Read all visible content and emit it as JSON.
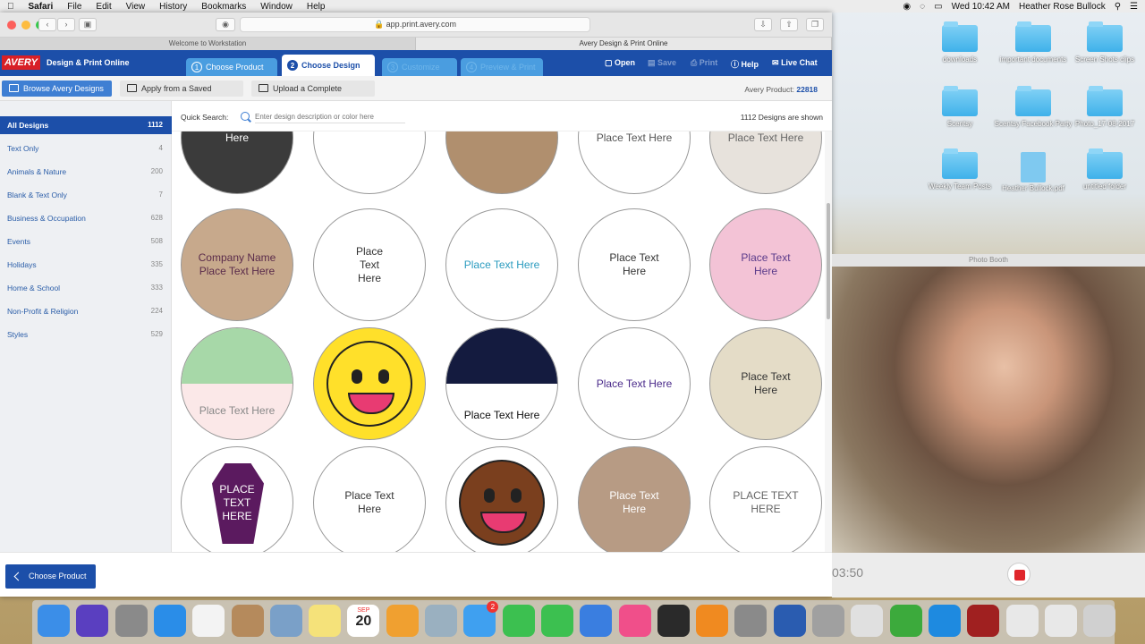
{
  "menubar": {
    "app": "Safari",
    "items": [
      "File",
      "Edit",
      "View",
      "History",
      "Bookmarks",
      "Window",
      "Help"
    ],
    "clock": "Wed 10:42 AM",
    "user": "Heather Rose Bullock"
  },
  "browser": {
    "url": "app.print.avery.com",
    "tabs": [
      "Welcome to Workstation",
      "Avery Design & Print Online"
    ]
  },
  "avery": {
    "logo": "AVERY",
    "product_label": "Design & Print Online",
    "steps": [
      {
        "num": "1",
        "label": "Choose Product"
      },
      {
        "num": "2",
        "label": "Choose Design"
      },
      {
        "num": "3",
        "label": "Customize"
      },
      {
        "num": "4",
        "label": "Preview & Print"
      }
    ],
    "actions": {
      "open": "Open",
      "save": "Save",
      "print": "Print",
      "help": "Help",
      "chat": "Live Chat"
    },
    "sub": {
      "browse": "Browse Avery Designs",
      "apply": "Apply from a Saved Project",
      "upload": "Upload a Complete Design",
      "product_label": "Avery Product:",
      "product_num": "22818"
    },
    "categories": [
      {
        "label": "All Designs",
        "count": "1112"
      },
      {
        "label": "Text Only",
        "count": "4"
      },
      {
        "label": "Animals & Nature",
        "count": "200"
      },
      {
        "label": "Blank & Text Only",
        "count": "7"
      },
      {
        "label": "Business & Occupation",
        "count": "628"
      },
      {
        "label": "Events",
        "count": "508"
      },
      {
        "label": "Holidays",
        "count": "335"
      },
      {
        "label": "Home & School",
        "count": "333"
      },
      {
        "label": "Non-Profit & Religion",
        "count": "224"
      },
      {
        "label": "Styles",
        "count": "529"
      }
    ],
    "search": {
      "label": "Quick Search:",
      "placeholder": "Enter design description or color here",
      "count": "1112 Designs are shown"
    },
    "designs": [
      {
        "text": "Here",
        "bg": "#3b3b3b",
        "color": "#fff"
      },
      {
        "text": "",
        "bg": "#ffffff",
        "color": "#555"
      },
      {
        "text": "",
        "bg": "#b08f6e",
        "color": "#fff"
      },
      {
        "text": "Place Text Here",
        "bg": "#ffffff",
        "color": "#555"
      },
      {
        "text": "Place Text Here",
        "bg": "#e7e2dc",
        "color": "#666"
      },
      {
        "text": "Company Name\nPlace Text Here",
        "bg": "#c7a98c",
        "color": "#5a2b4a"
      },
      {
        "text": "Place\nText\nHere",
        "bg": "#ffffff",
        "color": "#333"
      },
      {
        "text": "Place Text Here",
        "bg": "#ffffff",
        "color": "#2a9bbf"
      },
      {
        "text": "Place Text\nHere",
        "bg": "#ffffff",
        "color": "#333"
      },
      {
        "text": "Place Text\nHere",
        "bg": "#f3c3d6",
        "color": "#5a3a8a"
      },
      {
        "text": "Place Text Here",
        "bg": "#fbe8e8",
        "color": "#888"
      },
      {
        "text": "",
        "bg": "#ffe02a",
        "color": "#000"
      },
      {
        "text": "Place Text Here",
        "bg": "#ffffff",
        "color": "#111"
      },
      {
        "text": "Place Text Here",
        "bg": "#ffffff",
        "color": "#4a2a8a"
      },
      {
        "text": "Place Text\nHere",
        "bg": "#e4dcc7",
        "color": "#333"
      },
      {
        "text": "PLACE\nTEXT\nHERE",
        "bg": "#ffffff",
        "color": "#fff"
      },
      {
        "text": "Place Text\nHere",
        "bg": "#ffffff",
        "color": "#333"
      },
      {
        "text": "",
        "bg": "#ffffff",
        "color": "#333"
      },
      {
        "text": "Place Text\nHere",
        "bg": "#b79b84",
        "color": "#fff"
      },
      {
        "text": "PLACE TEXT\nHERE",
        "bg": "#ffffff",
        "color": "#666"
      }
    ],
    "footer_button": "Choose Product"
  },
  "photobooth": {
    "title": "Photo Booth",
    "timer": "03:50"
  },
  "desktop_icons": [
    {
      "label": "downloads"
    },
    {
      "label": "important documents"
    },
    {
      "label": "Screen Shots clips"
    },
    {
      "label": "Scentsy"
    },
    {
      "label": "Scentsy Facebook Party"
    },
    {
      "label": "Photo_17-08-2017"
    },
    {
      "label": "Weekly Team Posts"
    },
    {
      "label": "Heather Bullock.pdf"
    },
    {
      "label": "untitled folder"
    }
  ],
  "dock": {
    "calendar_day": "20",
    "calendar_month": "SEP",
    "badge": "2"
  }
}
